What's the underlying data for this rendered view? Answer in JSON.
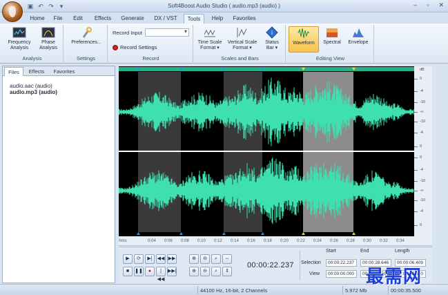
{
  "window": {
    "title": "Soft4Boost Audio Studio  ( audio.mp3 (audio) )",
    "controls": [
      "–",
      "▫",
      "✕"
    ]
  },
  "quick_access": [
    "save-icon",
    "undo-icon",
    "redo-icon",
    "dropdown-icon"
  ],
  "tabs": [
    {
      "label": "Home"
    },
    {
      "label": "File"
    },
    {
      "label": "Edit"
    },
    {
      "label": "Effects"
    },
    {
      "label": "Generate"
    },
    {
      "label": "DX / VST"
    },
    {
      "label": "Tools",
      "active": true
    },
    {
      "label": "Help"
    },
    {
      "label": "Favorites"
    }
  ],
  "ribbon": {
    "analysis": {
      "label": "Analysis",
      "frequency": "Frequency Analysis",
      "phase": "Phase Analysis"
    },
    "settings": {
      "label": "Settings",
      "preferences": "Preferences..."
    },
    "record": {
      "label": "Record",
      "record_input": "Record Input",
      "record_settings": "Record Settings"
    },
    "scales": {
      "label": "Scales and Bars",
      "time_scale": "Time Scale Format",
      "vertical_scale": "Vertical Scale Format",
      "status_bar": "Status Bar"
    },
    "editing_view": {
      "label": "Editing View",
      "waveform": "Waveform",
      "spectral": "Spectral",
      "envelope": "Envelope"
    }
  },
  "left_panel": {
    "tabs": [
      "Files",
      "Effects",
      "Favorites"
    ],
    "files": [
      "audio.aac (audio)",
      "audio.mp3 (audio)"
    ]
  },
  "waveform": {
    "db_unit": "dB",
    "db_labels": [
      "0",
      "-4",
      "-10",
      "-∞",
      "-10",
      "-4",
      "0"
    ],
    "time_labels": [
      "hms",
      "0:04",
      "0:06",
      "0:08",
      "0:10",
      "0:12",
      "0:14",
      "0:16",
      "0:18",
      "0:20",
      "0:22",
      "0:24",
      "0:26",
      "0:28",
      "0:30",
      "0:32",
      "0:34"
    ],
    "colors": {
      "wave": "#3fe0b0",
      "background": "#000000",
      "selection": "#8a8a8a",
      "region": "#3b3b3b",
      "marker_blue": "#2f8fe0",
      "marker_yellow": "#f0e020"
    }
  },
  "transport": {
    "current_time": "00:00:22.237",
    "selection_label": "Selection",
    "view_label": "View",
    "start_label": "Start",
    "end_label": "End",
    "length_label": "Length",
    "selection": {
      "start": "00:00:22.237",
      "end": "00:00:28.646",
      "length": "00:00:06.409"
    },
    "view": {
      "start": "00:00:00.000",
      "end": "00:00:35.500",
      "length": "00:00:35.500"
    }
  },
  "status": {
    "format": "44100 Hz, 16-bit, 2 Channels",
    "size": "5.972 Mb",
    "duration": "00:00:35.500"
  },
  "watermark": "最需网"
}
